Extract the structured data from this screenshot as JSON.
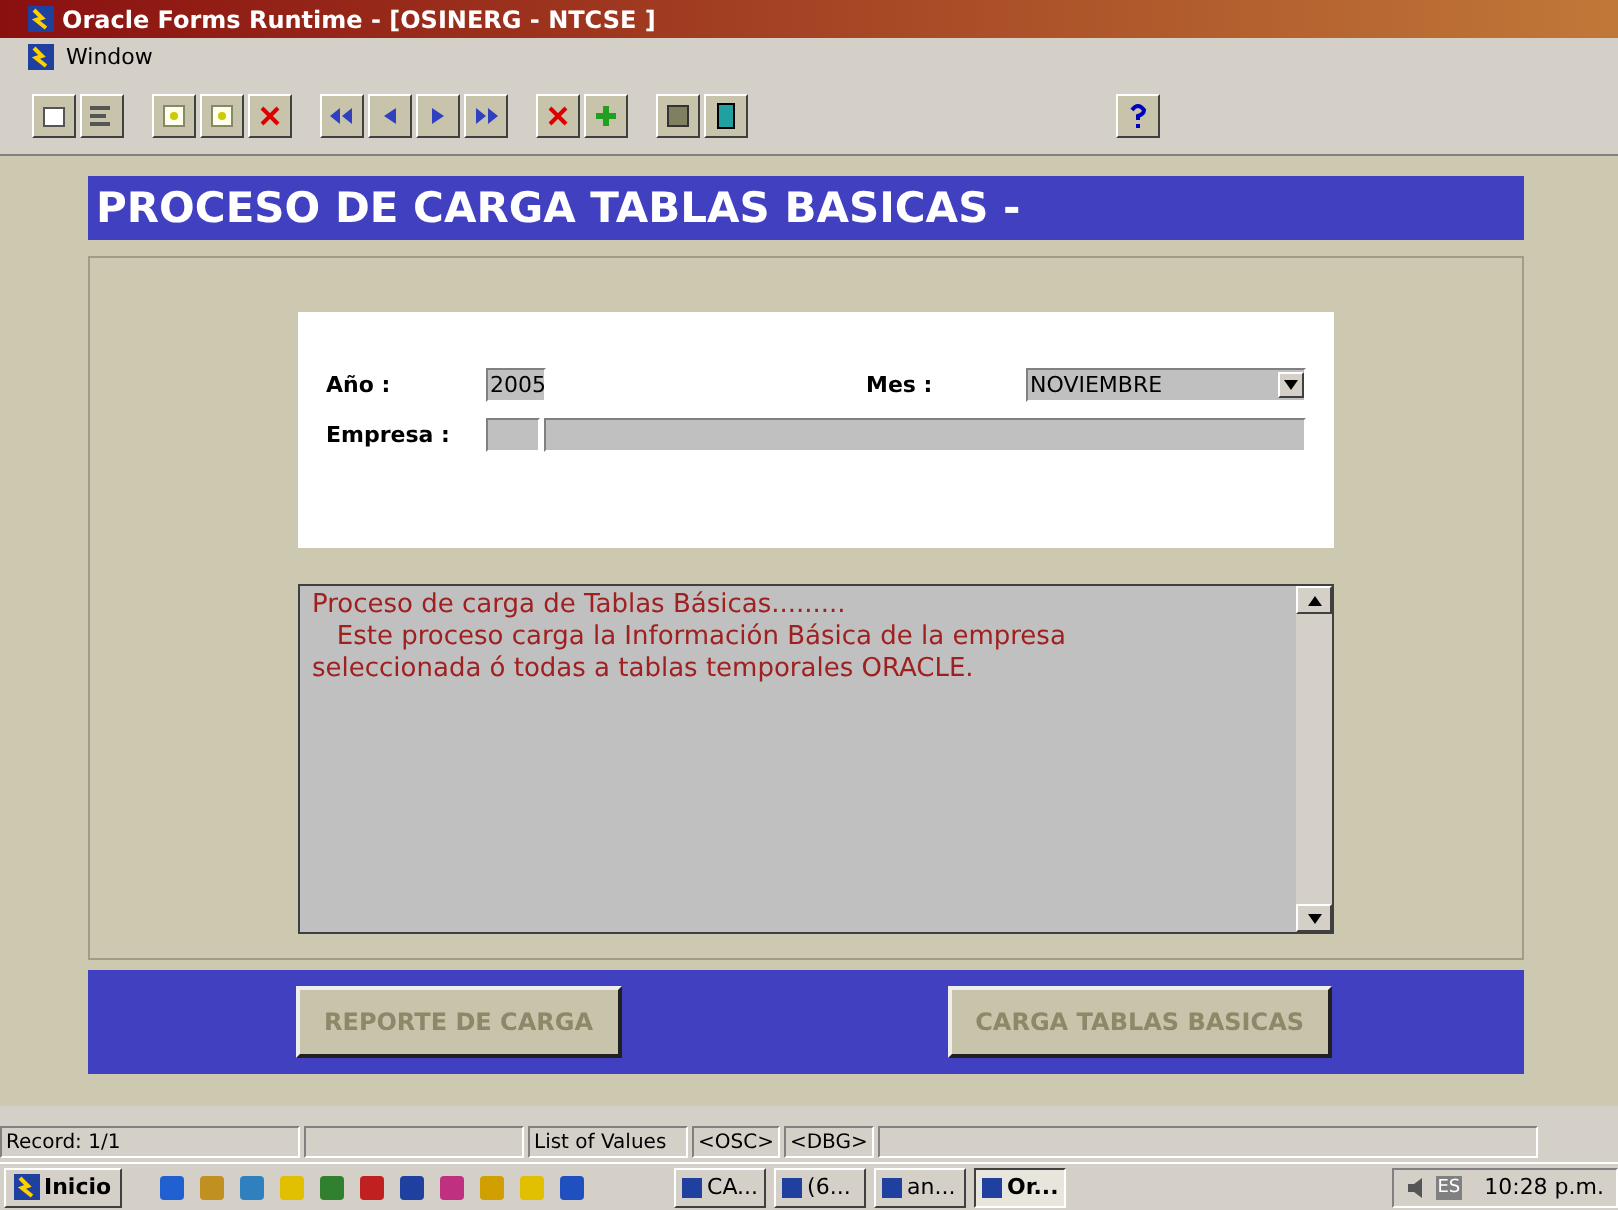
{
  "window": {
    "title": "Oracle Forms Runtime - [OSINERG - NTCSE ]"
  },
  "menu_bar": {
    "items": [
      "Window"
    ]
  },
  "form": {
    "header": "PROCESO DE CARGA TABLAS BASICAS -",
    "fields": [
      {
        "label": "Año :",
        "value": "2005"
      },
      {
        "label": "Mes :",
        "value": "NOVIEMBRE"
      },
      {
        "label": "Empresa  :"
      }
    ],
    "message_lines": [
      "Proceso de carga de Tablas Básicas.........",
      "   Este proceso carga la Información Básica de la empresa",
      "seleccionada ó todas a tablas temporales ORACLE."
    ],
    "buttons": [
      {
        "label": "REPORTE DE CARGA",
        "disabled": true
      },
      {
        "label": "CARGA TABLAS BASICAS",
        "disabled": true
      }
    ]
  },
  "status_bar": [
    "Record: 1/1",
    "List of Values",
    "<OSC>",
    "<DBG>"
  ],
  "taskbar": {
    "start": "Inicio",
    "tasks": [
      {
        "label": "CA...",
        "selected": false
      },
      {
        "label": "(6...",
        "selected": false
      },
      {
        "label": "an...",
        "selected": false
      },
      {
        "label": "Or...",
        "selected": true
      }
    ],
    "tray_language": "ES",
    "clock": "10:28 p.m."
  }
}
